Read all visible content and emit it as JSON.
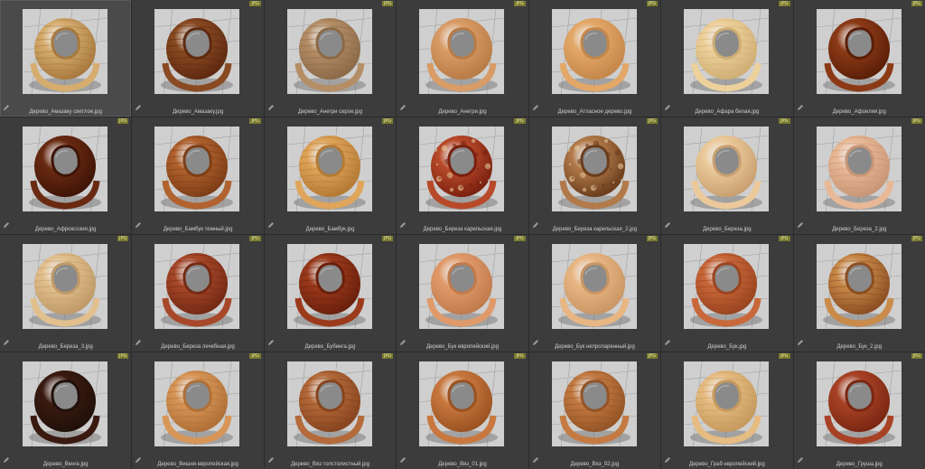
{
  "badge_label": "JPG",
  "icons": {
    "edit": "pencil-icon",
    "format": "file-format-badge"
  },
  "tiles": [
    {
      "name": "Дерево_Амазаку светлое.jpg",
      "color": "#d6ad6f",
      "grain": "#a8793e",
      "pattern": "stripe",
      "selected": true
    },
    {
      "name": "Дерево_Амазаку.jpg",
      "color": "#8a4a22",
      "grain": "#5e2a10",
      "pattern": "stripe"
    },
    {
      "name": "Дерево_Анегри серое.jpg",
      "color": "#b58e66",
      "grain": "#8c6a48",
      "pattern": "stripe"
    },
    {
      "name": "Дерево_Анегри.jpg",
      "color": "#d99c66",
      "grain": "#b87b46",
      "pattern": "plain"
    },
    {
      "name": "Дерево_Атласное дерево.jpg",
      "color": "#e3a767",
      "grain": "#c4874a",
      "pattern": "plain"
    },
    {
      "name": "Дерево_Афара белая.jpg",
      "color": "#edd09a",
      "grain": "#cfae74",
      "pattern": "stripe"
    },
    {
      "name": "Дерево_Афоелия.jpg",
      "color": "#8c3a16",
      "grain": "#5a1e08",
      "pattern": "plain"
    },
    {
      "name": "Дерево_Афроксозия.jpg",
      "color": "#6a2a12",
      "grain": "#3e1406",
      "pattern": "plain"
    },
    {
      "name": "Дерево_Бамбук темный.jpg",
      "color": "#b1622e",
      "grain": "#7e3e16",
      "pattern": "stripe"
    },
    {
      "name": "Дерево_Бамбук.jpg",
      "color": "#dfa55a",
      "grain": "#b47a34",
      "pattern": "stripe"
    },
    {
      "name": "Дерево_Береза карельская.jpg",
      "color": "#b84a2a",
      "grain": "#7a2010",
      "pattern": "burl"
    },
    {
      "name": "Дерево_Береза карельская_2.jpg",
      "color": "#b27a4a",
      "grain": "#6a3c1c",
      "pattern": "burl"
    },
    {
      "name": "Дерево_Береза.jpg",
      "color": "#ebc99a",
      "grain": "#c9a070",
      "pattern": "plain"
    },
    {
      "name": "Дерево_Береза_2.jpg",
      "color": "#e9b896",
      "grain": "#c89676",
      "pattern": "stripe"
    },
    {
      "name": "Дерево_Береза_3.jpg",
      "color": "#e2c08e",
      "grain": "#bf9a68",
      "pattern": "stripe"
    },
    {
      "name": "Дерево_Береза лечебная.jpg",
      "color": "#a8482a",
      "grain": "#742a14",
      "pattern": "stripe"
    },
    {
      "name": "Дерево_Бубинга.jpg",
      "color": "#9c3a1c",
      "grain": "#6a200c",
      "pattern": "stripe"
    },
    {
      "name": "Дерево_Бук европейский.jpg",
      "color": "#e09a6a",
      "grain": "#c07a4c",
      "pattern": "plain"
    },
    {
      "name": "Дерево_Бук непропаренный.jpg",
      "color": "#e8b682",
      "grain": "#c99664",
      "pattern": "plain"
    },
    {
      "name": "Дерево_Бук.jpg",
      "color": "#c9683a",
      "grain": "#9a4420",
      "pattern": "stripe"
    },
    {
      "name": "Дерево_Бук_2.jpg",
      "color": "#c98a4a",
      "grain": "#8c4e22",
      "pattern": "stripe"
    },
    {
      "name": "Дерево_Венге.jpg",
      "color": "#3a1a10",
      "grain": "#20100a",
      "pattern": "plain"
    },
    {
      "name": "Дерево_Вишня европейская.jpg",
      "color": "#d79658",
      "grain": "#b07036",
      "pattern": "stripe"
    },
    {
      "name": "Дерево_Вяз толстолистный.jpg",
      "color": "#b46a3a",
      "grain": "#86441e",
      "pattern": "stripe"
    },
    {
      "name": "Дерево_Вяз_01.jpg",
      "color": "#c8783e",
      "grain": "#9a5220",
      "pattern": "plain"
    },
    {
      "name": "Дерево_Вяз_02.jpg",
      "color": "#c47a42",
      "grain": "#945426",
      "pattern": "stripe"
    },
    {
      "name": "Дерево_Граб европейский.jpg",
      "color": "#e6bc82",
      "grain": "#c69a5e",
      "pattern": "stripe"
    },
    {
      "name": "Дерево_Груша.jpg",
      "color": "#a84226",
      "grain": "#7a2612",
      "pattern": "plain"
    }
  ]
}
